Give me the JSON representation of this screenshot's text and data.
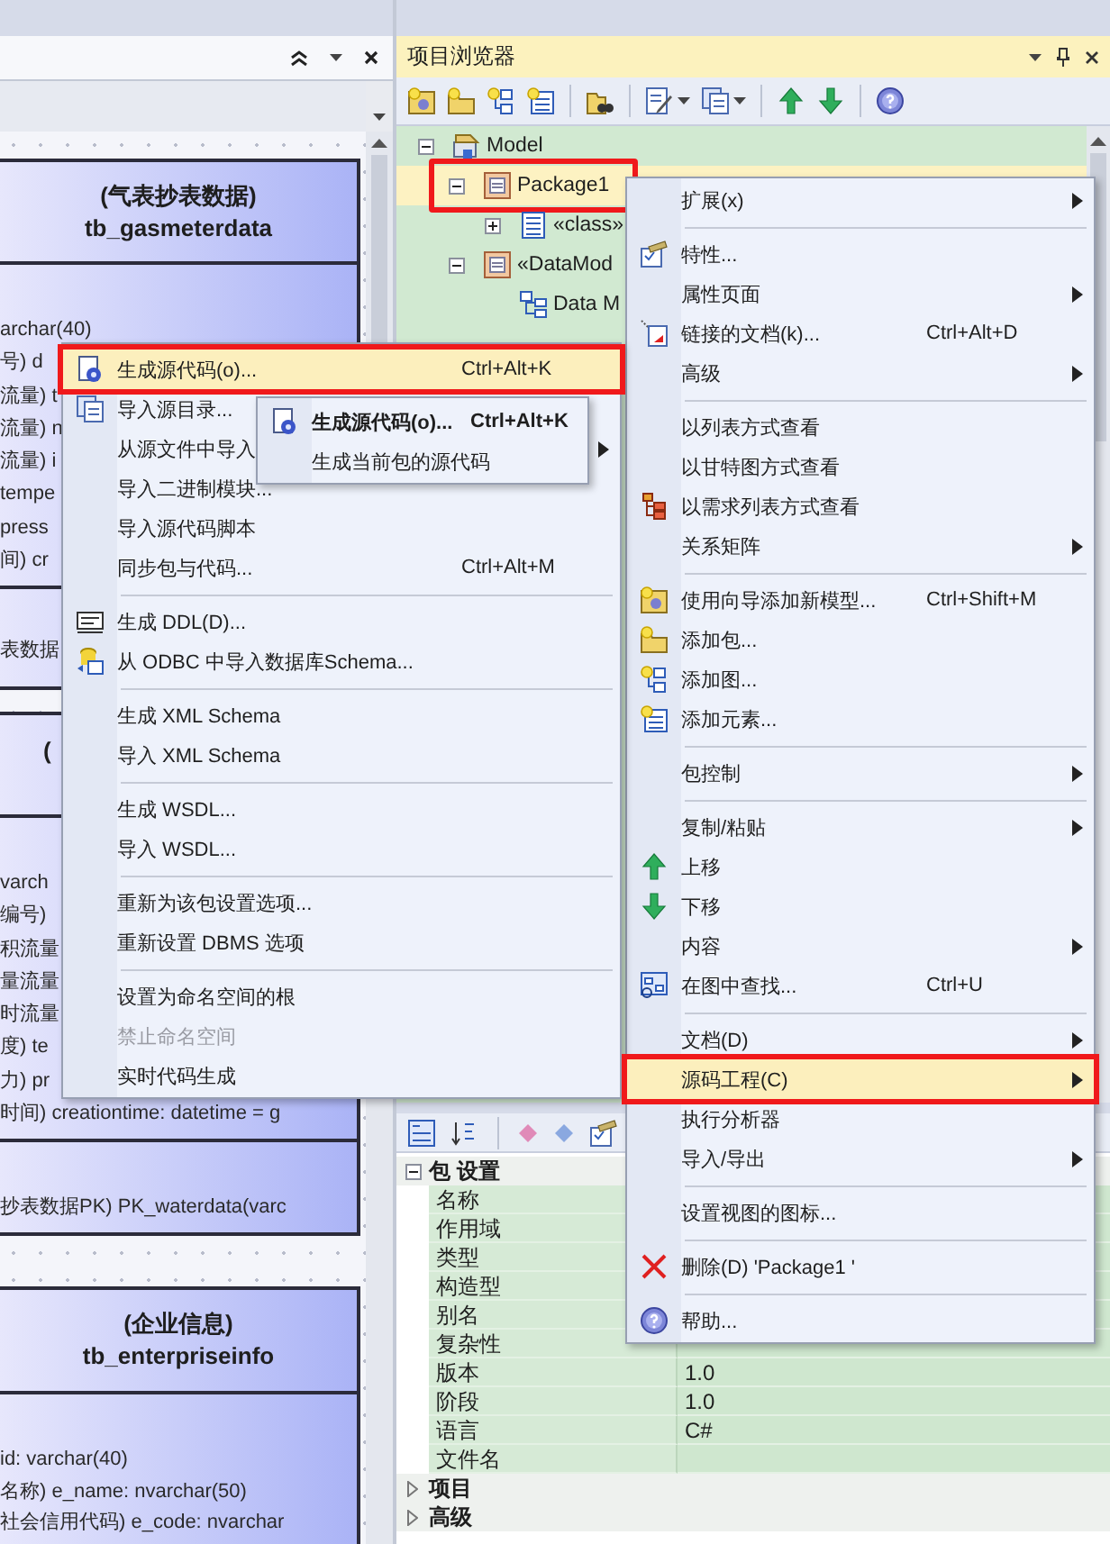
{
  "diagram": {
    "tables": [
      {
        "title": "(气表抄表数据)",
        "name": "tb_gasmeterdata",
        "attributes": [
          "archar(40)",
          "号) d",
          "流量) t",
          "流量) n",
          "流量) i",
          "tempe",
          "press",
          "间) cr"
        ],
        "operations": [
          "表数据"
        ]
      },
      {
        "title": "(",
        "attributes": [
          "varch",
          "编号)",
          "积流量",
          "量流量",
          "时流量",
          "度) te",
          "力) pr",
          "时间) creationtime: datetime = g"
        ],
        "operations": [
          "抄表数据PK) PK_waterdata(varc"
        ]
      },
      {
        "title": "(企业信息)",
        "name": "tb_enterpriseinfo",
        "attributes": [
          "id: varchar(40)",
          "名称) e_name: nvarchar(50)",
          "社会信用代码) e_code: nvarchar"
        ]
      }
    ]
  },
  "project_browser": {
    "title": "项目浏览器",
    "tree": [
      {
        "label": "Model",
        "kind": "model",
        "expanded": true,
        "selected": false,
        "marked": false,
        "children": [
          {
            "label": "Package1",
            "kind": "package",
            "expanded": true,
            "selected": true,
            "marked": true,
            "children": [
              {
                "label": "«class»",
                "kind": "element",
                "expanded": false,
                "selected": false,
                "marked": false
              }
            ]
          },
          {
            "label": "«DataMod",
            "kind": "package",
            "expanded": true,
            "selected": false,
            "marked": false,
            "children": [
              {
                "label": "Data M",
                "kind": "diagram",
                "selected": false,
                "marked": false
              }
            ]
          }
        ]
      }
    ]
  },
  "properties": {
    "groups": [
      {
        "label": "包 设置",
        "expanded": true,
        "rows": [
          {
            "name": "名称"
          },
          {
            "name": "作用域"
          },
          {
            "name": "类型"
          },
          {
            "name": "构造型"
          },
          {
            "name": "别名"
          },
          {
            "name": "复杂性"
          },
          {
            "name": "版本",
            "value": "1.0"
          },
          {
            "name": "阶段",
            "value": "1.0"
          },
          {
            "name": "语言",
            "value": "C#"
          },
          {
            "name": "文件名"
          }
        ]
      },
      {
        "label": "项目",
        "expanded": false
      },
      {
        "label": "高级",
        "expanded": false
      }
    ]
  },
  "context_menu": {
    "groups": [
      [
        {
          "label": "扩展(x)",
          "has_submenu": true,
          "selected": false,
          "marked": false
        }
      ],
      [
        {
          "label": "特性...",
          "has_submenu": false,
          "selected": false,
          "marked": false
        },
        {
          "label": "属性页面",
          "has_submenu": true,
          "selected": false,
          "marked": false
        },
        {
          "label": "链接的文档(k)...",
          "shortcut": "Ctrl+Alt+D",
          "has_submenu": false,
          "selected": false,
          "marked": false
        },
        {
          "label": "高级",
          "has_submenu": true,
          "selected": false,
          "marked": false
        }
      ],
      [
        {
          "label": "以列表方式查看",
          "has_submenu": false,
          "selected": false,
          "marked": false
        },
        {
          "label": "以甘特图方式查看",
          "has_submenu": false,
          "selected": false,
          "marked": false
        },
        {
          "label": "以需求列表方式查看",
          "has_submenu": false,
          "selected": false,
          "marked": false
        },
        {
          "label": "关系矩阵",
          "has_submenu": true,
          "selected": false,
          "marked": false
        }
      ],
      [
        {
          "label": "使用向导添加新模型...",
          "shortcut": "Ctrl+Shift+M",
          "has_submenu": false,
          "selected": false,
          "marked": false
        },
        {
          "label": "添加包...",
          "has_submenu": false,
          "selected": false,
          "marked": false
        },
        {
          "label": "添加图...",
          "has_submenu": false,
          "selected": false,
          "marked": false
        },
        {
          "label": "添加元素...",
          "has_submenu": false,
          "selected": false,
          "marked": false
        }
      ],
      [
        {
          "label": "包控制",
          "has_submenu": true,
          "selected": false,
          "marked": false
        }
      ],
      [
        {
          "label": "复制/粘贴",
          "has_submenu": true,
          "selected": false,
          "marked": false
        },
        {
          "label": "上移",
          "has_submenu": false,
          "selected": false,
          "marked": false
        },
        {
          "label": "下移",
          "has_submenu": false,
          "selected": false,
          "marked": false
        },
        {
          "label": "内容",
          "has_submenu": true,
          "selected": false,
          "marked": false
        },
        {
          "label": "在图中查找...",
          "shortcut": "Ctrl+U",
          "has_submenu": false,
          "selected": false,
          "marked": false
        }
      ],
      [
        {
          "label": "文档(D)",
          "has_submenu": true,
          "selected": false,
          "marked": false
        },
        {
          "label": "源码工程(C)",
          "has_submenu": true,
          "selected": true,
          "marked": true
        },
        {
          "label": "执行分析器",
          "has_submenu": false,
          "selected": false,
          "marked": false
        },
        {
          "label": "导入/导出",
          "has_submenu": true,
          "selected": false,
          "marked": false
        }
      ],
      [
        {
          "label": "设置视图的图标...",
          "has_submenu": false,
          "selected": false,
          "marked": false
        }
      ],
      [
        {
          "label": "删除(D) 'Package1 '",
          "has_submenu": false,
          "selected": false,
          "marked": false
        }
      ],
      [
        {
          "label": "帮助...",
          "has_submenu": false,
          "selected": false,
          "marked": false
        }
      ]
    ]
  },
  "code_menu": {
    "groups": [
      [
        {
          "label": "生成源代码(o)...",
          "shortcut": "Ctrl+Alt+K",
          "has_submenu": false,
          "selected": true,
          "marked": true,
          "disabled": false
        },
        {
          "label": "导入源目录...",
          "has_submenu": false,
          "selected": false,
          "marked": false,
          "disabled": false
        },
        {
          "label": "从源文件中导入",
          "has_submenu": true,
          "selected": false,
          "marked": false,
          "disabled": false
        },
        {
          "label": "导入二进制模块...",
          "has_submenu": false,
          "selected": false,
          "marked": false,
          "disabled": false
        },
        {
          "label": "导入源代码脚本",
          "has_submenu": false,
          "selected": false,
          "marked": false,
          "disabled": false
        },
        {
          "label": "同步包与代码...",
          "shortcut": "Ctrl+Alt+M",
          "has_submenu": false,
          "selected": false,
          "marked": false,
          "disabled": false
        }
      ],
      [
        {
          "label": "生成 DDL(D)...",
          "has_submenu": false,
          "selected": false,
          "marked": false,
          "disabled": false
        },
        {
          "label": "从 ODBC 中导入数据库Schema...",
          "has_submenu": false,
          "selected": false,
          "marked": false,
          "disabled": false
        }
      ],
      [
        {
          "label": "生成 XML Schema",
          "has_submenu": false,
          "selected": false,
          "marked": false,
          "disabled": false
        },
        {
          "label": "导入 XML Schema",
          "has_submenu": false,
          "selected": false,
          "marked": false,
          "disabled": false
        }
      ],
      [
        {
          "label": "生成 WSDL...",
          "has_submenu": false,
          "selected": false,
          "marked": false,
          "disabled": false
        },
        {
          "label": "导入 WSDL...",
          "has_submenu": false,
          "selected": false,
          "marked": false,
          "disabled": false
        }
      ],
      [
        {
          "label": "重新为该包设置选项...",
          "has_submenu": false,
          "selected": false,
          "marked": false,
          "disabled": false
        },
        {
          "label": "重新设置 DBMS 选项",
          "has_submenu": false,
          "selected": false,
          "marked": false,
          "disabled": false
        }
      ],
      [
        {
          "label": "设置为命名空间的根",
          "has_submenu": false,
          "selected": false,
          "marked": false,
          "disabled": false
        },
        {
          "label": "禁止命名空间",
          "has_submenu": false,
          "selected": false,
          "marked": false,
          "disabled": true
        },
        {
          "label": "实时代码生成",
          "has_submenu": false,
          "selected": false,
          "marked": false,
          "disabled": false
        }
      ]
    ]
  },
  "code_submenu": {
    "items": [
      {
        "label": "生成源代码(o)...",
        "shortcut": "Ctrl+Alt+K",
        "default": true
      },
      {
        "label": "生成当前包的源代码",
        "default": false
      }
    ]
  }
}
